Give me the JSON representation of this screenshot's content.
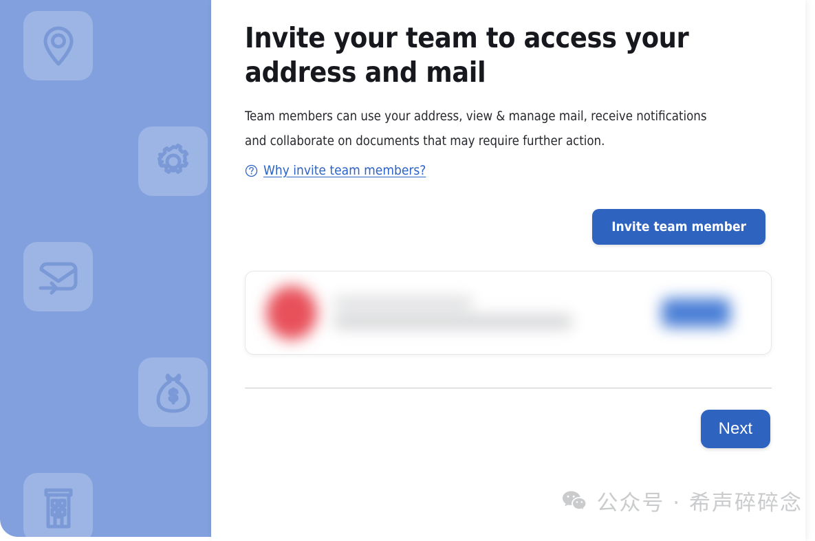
{
  "sidebar": {
    "background_color": "#82a0dd",
    "tile_color": "rgba(255,255,255,0.22)",
    "icons": [
      {
        "name": "location-pin-icon"
      },
      {
        "name": "gear-icon"
      },
      {
        "name": "envelope-forward-icon"
      },
      {
        "name": "money-bag-icon"
      },
      {
        "name": "office-building-icon"
      }
    ]
  },
  "main": {
    "title": "Invite your team to access your address and mail",
    "description": "Team members can use your address, view & manage mail, receive notifications and collaborate on documents that may require further action.",
    "help_link": {
      "label": "Why invite team members?",
      "icon": "question-circle-icon",
      "color": "#2b62c6"
    },
    "invite_button": {
      "label": "Invite team member",
      "color": "#2f63c0"
    },
    "member_card": {
      "blurred": true,
      "avatar": {
        "name": "member-avatar",
        "color": "#e8505a"
      },
      "name_line": "",
      "email_line": "",
      "badge": {
        "label": "",
        "color": "#4a7fd6"
      }
    },
    "next_button": {
      "label": "Next",
      "color": "#2f63c0"
    }
  },
  "watermark": {
    "icon": "wechat-icon",
    "text": "公众号 · 希声碎碎念",
    "color": "#c9cbcd"
  }
}
